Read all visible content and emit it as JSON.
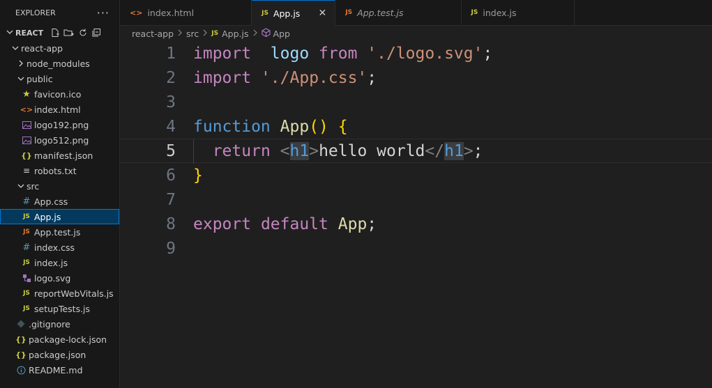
{
  "explorer": {
    "title": "EXPLORER",
    "more_label": "···",
    "section_label": "REACT",
    "tree": [
      {
        "label": "react-app",
        "depth": 1,
        "type": "folder-open",
        "icon": "chevron-down-icon"
      },
      {
        "label": "node_modules",
        "depth": 2,
        "type": "folder",
        "icon": "chevron-right-icon"
      },
      {
        "label": "public",
        "depth": 2,
        "type": "folder-open",
        "icon": "chevron-down-icon"
      },
      {
        "label": "favicon.ico",
        "depth": 3,
        "type": "file",
        "icon": "star-icon"
      },
      {
        "label": "index.html",
        "depth": 3,
        "type": "file",
        "icon": "html-icon"
      },
      {
        "label": "logo192.png",
        "depth": 3,
        "type": "file",
        "icon": "image-icon"
      },
      {
        "label": "logo512.png",
        "depth": 3,
        "type": "file",
        "icon": "image-icon"
      },
      {
        "label": "manifest.json",
        "depth": 3,
        "type": "file",
        "icon": "json-icon"
      },
      {
        "label": "robots.txt",
        "depth": 3,
        "type": "file",
        "icon": "text-icon"
      },
      {
        "label": "src",
        "depth": 2,
        "type": "folder-open",
        "icon": "chevron-down-icon"
      },
      {
        "label": "App.css",
        "depth": 3,
        "type": "file",
        "icon": "css-icon"
      },
      {
        "label": "App.js",
        "depth": 3,
        "type": "file",
        "icon": "js-icon",
        "selected": true
      },
      {
        "label": "App.test.js",
        "depth": 3,
        "type": "file",
        "icon": "js-test-icon"
      },
      {
        "label": "index.css",
        "depth": 3,
        "type": "file",
        "icon": "css-icon"
      },
      {
        "label": "index.js",
        "depth": 3,
        "type": "file",
        "icon": "js-icon"
      },
      {
        "label": "logo.svg",
        "depth": 3,
        "type": "file",
        "icon": "svg-icon"
      },
      {
        "label": "reportWebVitals.js",
        "depth": 3,
        "type": "file",
        "icon": "js-icon"
      },
      {
        "label": "setupTests.js",
        "depth": 3,
        "type": "file",
        "icon": "js-icon"
      },
      {
        "label": ".gitignore",
        "depth": 2,
        "type": "file",
        "icon": "git-icon"
      },
      {
        "label": "package-lock.json",
        "depth": 2,
        "type": "file",
        "icon": "json-icon"
      },
      {
        "label": "package.json",
        "depth": 2,
        "type": "file",
        "icon": "json-icon"
      },
      {
        "label": "README.md",
        "depth": 2,
        "type": "file",
        "icon": "info-icon"
      }
    ]
  },
  "tabs": [
    {
      "label": "index.html",
      "icon": "html-icon",
      "active": false,
      "italic": false
    },
    {
      "label": "App.js",
      "icon": "js-icon",
      "active": true,
      "italic": false,
      "close": "✕"
    },
    {
      "label": "App.test.js",
      "icon": "js-test-icon",
      "active": false,
      "italic": true
    },
    {
      "label": "index.js",
      "icon": "js-icon",
      "active": false,
      "italic": false
    }
  ],
  "breadcrumb": {
    "parts": [
      "react-app",
      "src",
      "App.js",
      "App"
    ]
  },
  "editor": {
    "current_line": 5,
    "lines": [
      {
        "num": "1",
        "tokens": [
          [
            "kw",
            "import"
          ],
          [
            "",
            "  "
          ],
          [
            "var",
            "logo"
          ],
          [
            "",
            " "
          ],
          [
            "kw",
            "from"
          ],
          [
            "",
            " "
          ],
          [
            "str",
            "'./logo.svg'"
          ],
          [
            "",
            ";"
          ]
        ]
      },
      {
        "num": "2",
        "tokens": [
          [
            "kw",
            "import"
          ],
          [
            "",
            " "
          ],
          [
            "str",
            "'./App.css'"
          ],
          [
            "",
            ";"
          ]
        ]
      },
      {
        "num": "3",
        "tokens": []
      },
      {
        "num": "4",
        "tokens": [
          [
            "kwb",
            "function"
          ],
          [
            "",
            " "
          ],
          [
            "fn",
            "App"
          ],
          [
            "br",
            "()"
          ],
          [
            "",
            " "
          ],
          [
            "br",
            "{"
          ]
        ]
      },
      {
        "num": "5",
        "tokens": [
          [
            "",
            "  "
          ],
          [
            "kw",
            "return"
          ],
          [
            "",
            " "
          ],
          [
            "punct",
            "<"
          ],
          [
            "tag tagbg",
            "h1"
          ],
          [
            "punct",
            ">"
          ],
          [
            "",
            "hello world"
          ],
          [
            "punct",
            "</"
          ],
          [
            "tag tagbg",
            "h1"
          ],
          [
            "punct",
            ">"
          ],
          [
            "",
            ";"
          ]
        ]
      },
      {
        "num": "6",
        "tokens": [
          [
            "br",
            "}"
          ]
        ]
      },
      {
        "num": "7",
        "tokens": []
      },
      {
        "num": "8",
        "tokens": [
          [
            "kw",
            "export"
          ],
          [
            "",
            " "
          ],
          [
            "kw",
            "default"
          ],
          [
            "",
            " "
          ],
          [
            "fn",
            "App"
          ],
          [
            "",
            ";"
          ]
        ]
      },
      {
        "num": "9",
        "tokens": []
      }
    ]
  }
}
